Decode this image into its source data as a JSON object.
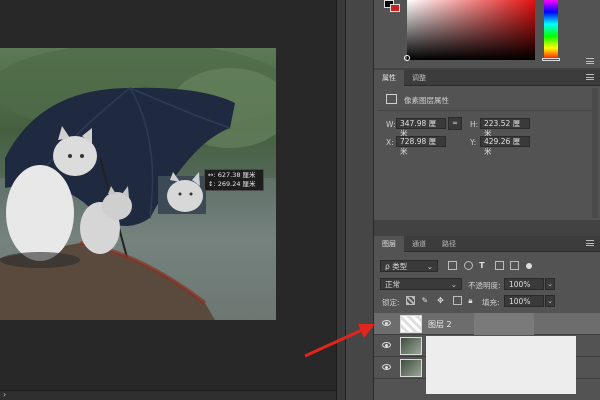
{
  "canvas": {
    "tooltip": {
      "width_line": "627.38 厘米",
      "height_line": "269.24 厘米",
      "w_symbol": "↔:",
      "h_symbol": "↕:"
    },
    "status_glyph": "›"
  },
  "color_picker": {
    "hue_colors": [
      "#ff0000",
      "#ffff00",
      "#00ff00",
      "#00ffff",
      "#0000ff",
      "#ff00ff",
      "#ff0000"
    ],
    "fg": "#000000",
    "bg": "#cc1f1f"
  },
  "properties_panel": {
    "tabs": [
      {
        "label": "属性"
      },
      {
        "label": "调整"
      }
    ],
    "header": "像素图层属性",
    "w_label": "W:",
    "w_value": "347.98 厘米",
    "h_label": "H:",
    "h_value": "223.52 厘米",
    "x_label": "X:",
    "x_value": "728.98 厘米",
    "y_label": "Y:",
    "y_value": "429.26 厘米",
    "link_icon": "link-icon"
  },
  "layers_panel": {
    "tabs": [
      {
        "label": "图层"
      },
      {
        "label": "通道"
      },
      {
        "label": "路径"
      }
    ],
    "filter_label": "ρ 类型",
    "blend_mode": "正常",
    "opacity_label": "不透明度:",
    "opacity_value": "100%",
    "lock_label": "锁定:",
    "fill_label": "填充:",
    "fill_value": "100%",
    "layers": [
      {
        "name": "图层 2"
      },
      {
        "name": ""
      },
      {
        "name": ""
      }
    ]
  },
  "accent": {
    "arrow": "#e0251c"
  }
}
